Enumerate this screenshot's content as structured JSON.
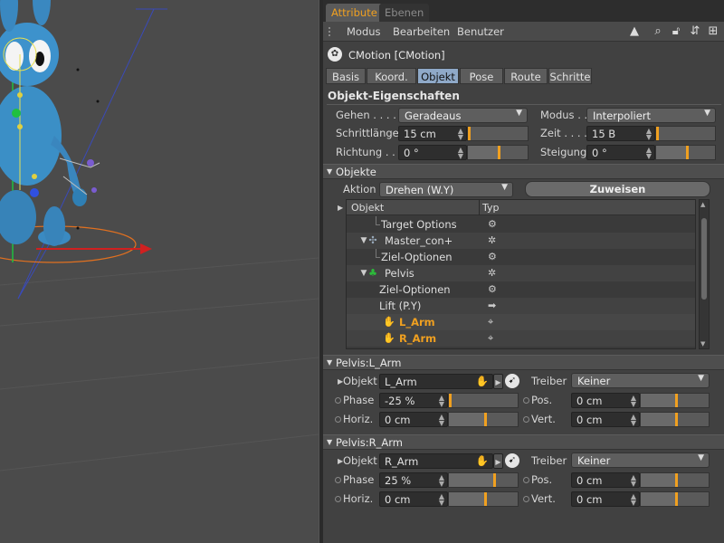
{
  "panel": {
    "tabs": [
      "Attribute",
      "Ebenen"
    ],
    "menu": [
      "Modus",
      "Bearbeiten",
      "Benutzer"
    ],
    "object_title": "CMotion [CMotion]",
    "subtabs": [
      "Basis",
      "Koord.",
      "Objekt",
      "Pose",
      "Route",
      "Schritte"
    ],
    "active_subtab": "Objekt",
    "section_title": "Objekt-Eigenschaften"
  },
  "props": {
    "gehen_label": "Gehen . . . . .",
    "gehen_value": "Geradeaus",
    "modus_label": "Modus . .",
    "modus_value": "Interpoliert",
    "schrittlaenge_label": "Schrittlänge",
    "schrittlaenge_value": "15 cm",
    "zeit_label": "Zeit . . . .",
    "zeit_value": "15 B",
    "richtung_label": "Richtung . .",
    "richtung_value": "0 °",
    "steigung_label": "Steigung",
    "steigung_value": "0 °"
  },
  "objekte": {
    "title": "Objekte",
    "aktion_label": "Aktion",
    "aktion_value": "Drehen (W.Y)",
    "zuweisen_label": "Zuweisen",
    "col_objekt": "Objekt",
    "col_typ": "Typ",
    "rows": [
      {
        "name": "Target Options",
        "typ": "⚙"
      },
      {
        "name": "Master_con+",
        "typ": "✲"
      },
      {
        "name": "Ziel-Optionen",
        "typ": "⚙"
      },
      {
        "name": "Pelvis",
        "typ": "✲"
      },
      {
        "name": "Ziel-Optionen",
        "typ": "⚙"
      },
      {
        "name": "Lift (P.Y)",
        "typ": "➡"
      },
      {
        "name": "L_Arm",
        "typ": "⌖"
      },
      {
        "name": "R_Arm",
        "typ": "⌖"
      }
    ]
  },
  "pelvis_l": {
    "title": "Pelvis:L_Arm",
    "objekt_label": "Objekt",
    "objekt_value": "L_Arm",
    "treiber_label": "Treiber",
    "treiber_value": "Keiner",
    "phase_label": "Phase",
    "phase_value": "-25 %",
    "pos_label": "Pos.",
    "pos_value": "0 cm",
    "horiz_label": "Horiz.",
    "horiz_value": "0 cm",
    "vert_label": "Vert.",
    "vert_value": "0 cm"
  },
  "pelvis_r": {
    "title": "Pelvis:R_Arm",
    "objekt_label": "Objekt",
    "objekt_value": "R_Arm",
    "treiber_label": "Treiber",
    "treiber_value": "Keiner",
    "phase_label": "Phase",
    "phase_value": "25 %",
    "pos_label": "Pos.",
    "pos_value": "0 cm",
    "horiz_label": "Horiz.",
    "horiz_value": "0 cm",
    "vert_label": "Vert.",
    "vert_value": "0 cm"
  },
  "colors": {
    "accent": "#f0a020",
    "active_tab": "#8fa9c8",
    "panel_bg": "#414141",
    "viewport_bg": "#4b4b4b"
  }
}
